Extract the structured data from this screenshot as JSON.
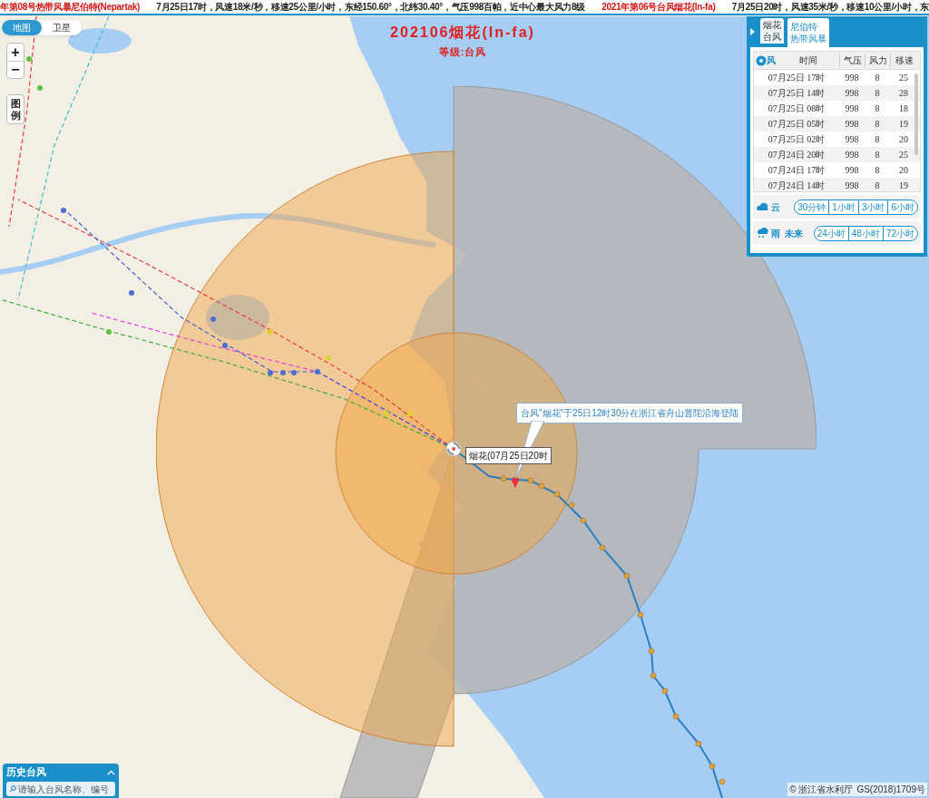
{
  "ticker": [
    {
      "kind": "title",
      "text": "年第08号热带风暴尼伯特(Nepartak)"
    },
    {
      "kind": "detail",
      "text": "7月25日17时，风速18米/秒，移速25公里/小时，东经150.60°，北纬30.40°，气压998百帕，近中心最大风力8级"
    },
    {
      "kind": "title",
      "text": "2021年第06号台风烟花(In-fa)"
    },
    {
      "kind": "detail",
      "text": "7月25日20时，风速35米/秒，移速10公里/小时，东"
    }
  ],
  "map_type_toggle": [
    {
      "label": "地图",
      "selected": true
    },
    {
      "label": "卫星",
      "selected": false
    }
  ],
  "zoom_controls": [
    "+",
    "−"
  ],
  "legend_button": "图例",
  "typhoon_title": {
    "name": "202106烟花(In-fa)",
    "level": "等级:台风"
  },
  "landfall_callout": "台风\"烟花\"于25日12时30分在浙江省舟山普陀沿海登陆",
  "position_label": "烟花(07月25日20时",
  "panel": {
    "tabs": [
      {
        "lines": [
          "烟花",
          "台风"
        ],
        "selected": false
      },
      {
        "lines": [
          "尼伯特",
          "热带风暴"
        ],
        "selected": true
      }
    ],
    "table": {
      "icon_label": "风",
      "columns": [
        "时间",
        "气压",
        "风力",
        "移速"
      ],
      "rows": [
        [
          "07月25日 17时",
          "998",
          "8",
          "25"
        ],
        [
          "07月25日 14时",
          "998",
          "8",
          "28"
        ],
        [
          "07月25日 08时",
          "998",
          "8",
          "18"
        ],
        [
          "07月25日 05时",
          "998",
          "8",
          "19"
        ],
        [
          "07月25日 02时",
          "998",
          "8",
          "20"
        ],
        [
          "07月24日 20时",
          "998",
          "8",
          "25"
        ],
        [
          "07月24日 17时",
          "998",
          "8",
          "20"
        ],
        [
          "07月24日 14时",
          "998",
          "8",
          "19"
        ]
      ]
    },
    "cloud": {
      "icon_label": "云",
      "buttons": [
        "30分钟",
        "1小时",
        "3小时",
        "6小时"
      ]
    },
    "rain": {
      "icon_label": "雨",
      "label": "未来",
      "buttons": [
        "24小时",
        "48小时",
        "72小时"
      ]
    }
  },
  "history_panel": {
    "title": "历史台风",
    "search_placeholder": "请输入台风名称、编号"
  },
  "attribution": {
    "copyright": "© 浙江省水利厅",
    "license": "GS(2018)1709号"
  }
}
